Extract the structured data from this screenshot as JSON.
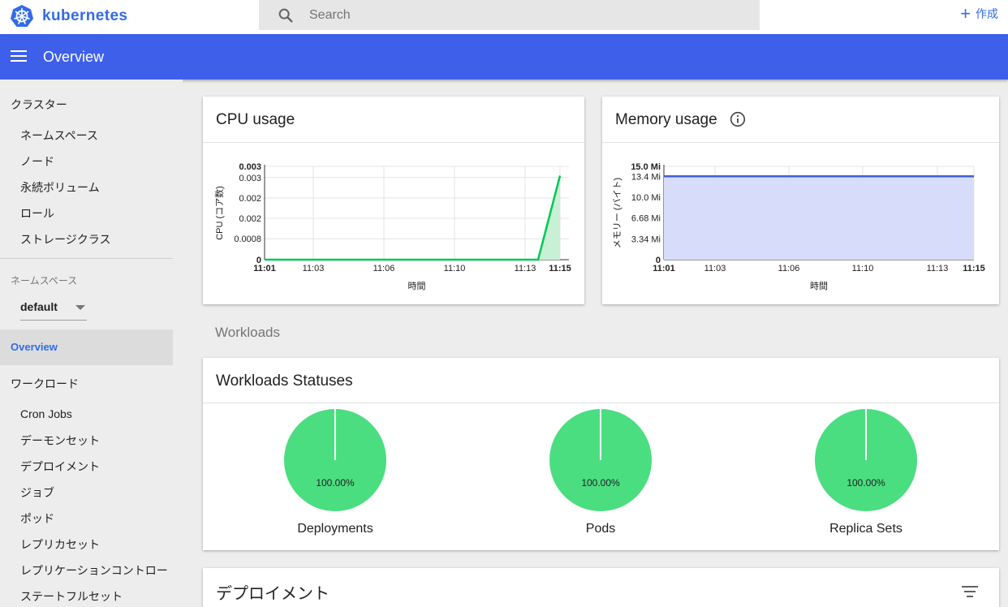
{
  "brand": {
    "name": "kubernetes"
  },
  "search": {
    "placeholder": "Search"
  },
  "header": {
    "create_label": "作成",
    "page_title": "Overview"
  },
  "sidebar": {
    "cluster_heading": "クラスター",
    "cluster_items": [
      "ネームスペース",
      "ノード",
      "永続ボリューム",
      "ロール",
      "ストレージクラス"
    ],
    "namespace_label": "ネームスペース",
    "namespace_value": "default",
    "active_item": "Overview",
    "workload_heading": "ワークロード",
    "workload_items": [
      "Cron Jobs",
      "デーモンセット",
      "デプロイメント",
      "ジョブ",
      "ポッド",
      "レプリカセット",
      "レプリケーションコントロー",
      "ステートフルセット"
    ]
  },
  "cpu_card": {
    "title": "CPU usage"
  },
  "memory_card": {
    "title": "Memory usage"
  },
  "workloads_section": {
    "label": "Workloads"
  },
  "statuses_card": {
    "title": "Workloads Statuses"
  },
  "deployments_card": {
    "title": "デプロイメント"
  },
  "colors": {
    "accent": "#326ce5",
    "bluebar": "#3d5fe9",
    "cpu_line": "#00c853",
    "memory_line": "#3f5fd9",
    "pie_green": "#4ade80"
  },
  "chart_data": [
    {
      "type": "line",
      "title": "CPU usage",
      "xlabel": "時間",
      "ylabel": "CPU (コア数)",
      "x": [
        "11:01",
        "11:03",
        "11:06",
        "11:10",
        "11:13",
        "11:15"
      ],
      "x_tick_bold": [
        "11:01",
        "11:15"
      ],
      "y_ticks": [
        "0",
        "0.0008",
        "0.002",
        "0.002",
        "0.003",
        "0.003"
      ],
      "y_tick_bold": [
        "0",
        "0.003"
      ],
      "ylim": [
        0,
        0.003
      ],
      "series": [
        {
          "values": [
            0,
            0,
            0,
            0,
            0,
            0.0027
          ]
        }
      ],
      "grid": true
    },
    {
      "type": "area",
      "title": "Memory usage",
      "xlabel": "時間",
      "ylabel": "メモリー (バイト)",
      "x": [
        "11:01",
        "11:03",
        "11:06",
        "11:10",
        "11:13",
        "11:15"
      ],
      "x_tick_bold": [
        "11:01",
        "11:15"
      ],
      "y_ticks": [
        "0",
        "3.34 Mi",
        "6.68 Mi",
        "10.0 Mi",
        "13.4 Mi",
        "15.0 Mi"
      ],
      "y_tick_bold": [
        "0",
        "15.0 Mi"
      ],
      "ylim": [
        0,
        15.0
      ],
      "series": [
        {
          "values": [
            13.4,
            13.4,
            13.4,
            13.4,
            13.4,
            13.4
          ]
        }
      ],
      "grid": true
    },
    {
      "type": "pie",
      "charts": [
        {
          "label": "Deployments",
          "percent_label": "100.00%",
          "value": 100
        },
        {
          "label": "Pods",
          "percent_label": "100.00%",
          "value": 100
        },
        {
          "label": "Replica Sets",
          "percent_label": "100.00%",
          "value": 100
        }
      ]
    }
  ]
}
